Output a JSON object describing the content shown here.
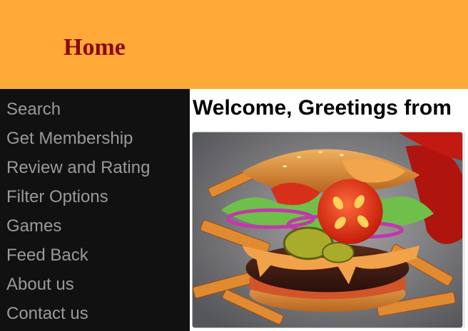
{
  "header": {
    "title": "Home"
  },
  "sidebar": {
    "items": [
      {
        "label": "Search"
      },
      {
        "label": "Get Membership"
      },
      {
        "label": "Review and Rating"
      },
      {
        "label": "Filter Options"
      },
      {
        "label": "Games"
      },
      {
        "label": "Feed Back"
      },
      {
        "label": "About us"
      },
      {
        "label": "Contact us"
      }
    ]
  },
  "main": {
    "welcome": "Welcome, Greetings from",
    "image": {
      "icon": "burger-photo"
    }
  },
  "colors": {
    "header_bg": "#ffa938",
    "title": "#8b0a0a",
    "sidebar_bg": "#111111",
    "sidebar_text": "#9a9a9a"
  }
}
